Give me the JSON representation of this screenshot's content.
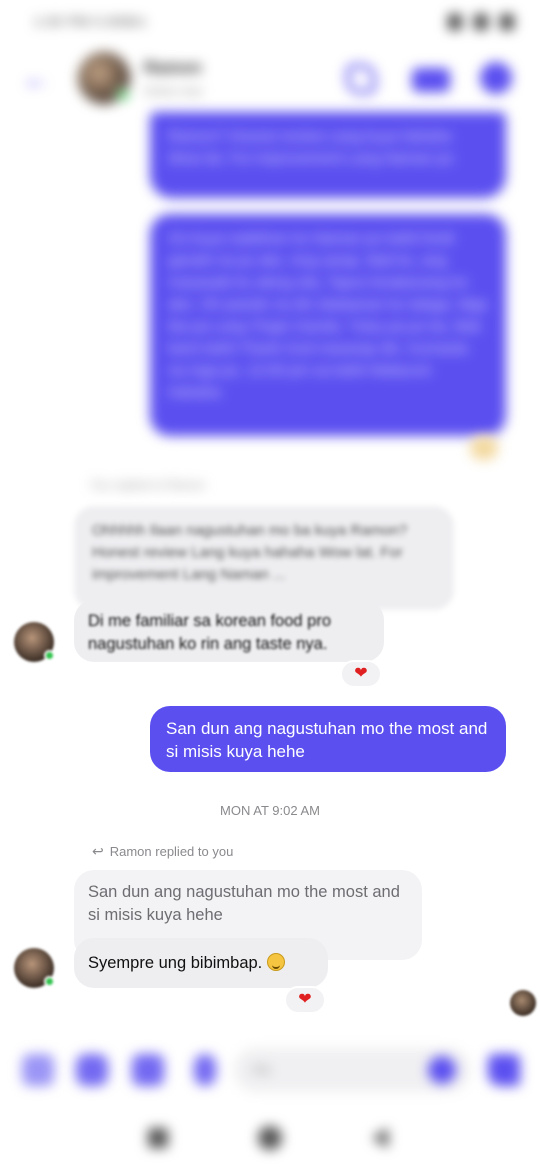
{
  "status_bar": {
    "time": "1:00 PM 0.0KB/s"
  },
  "header": {
    "contact_name": "Ramon",
    "contact_sub": "Active now"
  },
  "messages": {
    "blurred_out_1": "Ramon? Honest review Lang kuya hahaha Wow lat. For improvement Lang Naman po",
    "blurred_out_2": "Oo kuya nadeliver ko Naman po kahit hindi ganahi na po ako. Ang sarap. Bati ko, ang masasabi ko aking sila, Tapos kinakanang ko ako. Oh pwede na din dadaanan ko talaga. Mga iba pa Lang Tingin Ganda. Tuloy pa po ba. Bati kami kahit Thank God masarap din. Kumasta na mga po. 12:00 pm sa kahit Walacom Hahaha",
    "reply_meta_top": "You replied to Ramon",
    "quoted_blurred": "Ohhhhh Ilaan nagustuhan mo ba kuya Ramon? Honest review Lang kuya hahaha Wow lat. For improvement Lang Naman ...",
    "incoming_1": "Di me familiar sa korean food pro nagustuhan ko rin ang taste nya.",
    "outgoing_1": "San dun ang nagustuhan mo the most and si misis kuya hehe",
    "timestamp": "MON AT 9:02 AM",
    "reply_meta": "Ramon replied to you",
    "quoted_reply": "San dun ang nagustuhan mo the most and si misis kuya hehe",
    "incoming_2": "Syempre ung bibimbap.",
    "reaction_1": "❤",
    "reaction_2": "❤"
  },
  "composer": {
    "placeholder": "Aa"
  },
  "colors": {
    "accent": "#5b4ff0",
    "incoming_bg": "#eeeef1",
    "online": "#31c24d"
  }
}
